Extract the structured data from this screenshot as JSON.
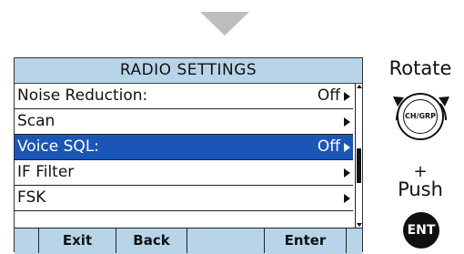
{
  "screen": {
    "title": "RADIO SETTINGS",
    "menu": [
      {
        "label": "Noise Reduction:",
        "value": "Off",
        "selected": false
      },
      {
        "label": "Scan",
        "value": "",
        "selected": false
      },
      {
        "label": "Voice SQL:",
        "value": "Off",
        "selected": true
      },
      {
        "label": "IF Filter",
        "value": "",
        "selected": false
      },
      {
        "label": "FSK",
        "value": "",
        "selected": false
      }
    ],
    "softkeys": [
      "Exit",
      "Back",
      "",
      "Enter"
    ],
    "colors": {
      "titlebar": "#b8d4e8",
      "selection": "#1a56b8"
    }
  },
  "controls": {
    "rotate_label": "Rotate",
    "knob_label": "CH/GRP",
    "plus": "+",
    "push_label": "Push",
    "ent_label": "ENT"
  }
}
